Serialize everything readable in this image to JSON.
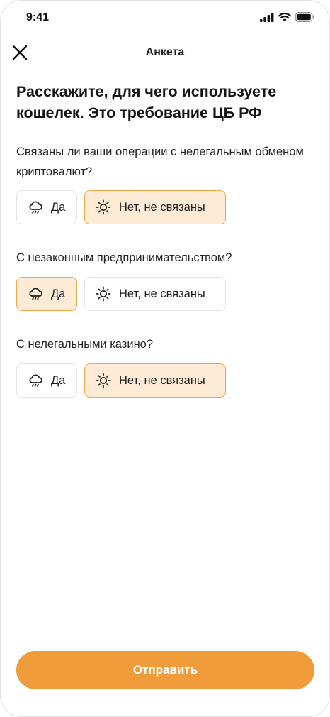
{
  "status_bar": {
    "time": "9:41"
  },
  "header": {
    "title": "Анкета",
    "close_icon": "close-icon"
  },
  "page": {
    "title": "Расскажите, для чего используете кошелек. Это требование ЦБ РФ"
  },
  "questions": [
    {
      "text": "Связаны ли ваши операции с нелегальным обменом криптовалют?",
      "yes_label": "Да",
      "no_label": "Нет, не связаны",
      "selected": "no"
    },
    {
      "text": "С незаконным предпринимательством?",
      "yes_label": "Да",
      "no_label": "Нет, не связаны",
      "selected": "yes"
    },
    {
      "text": "С нелегальными казино?",
      "yes_label": "Да",
      "no_label": "Нет, не связаны",
      "selected": "no"
    }
  ],
  "submit": {
    "label": "Отправить"
  },
  "colors": {
    "accent": "#f19c3a",
    "selected_bg": "#fdebd5",
    "selected_border": "#f0a749",
    "border": "#e3e3e3",
    "text": "#141414"
  },
  "icons": {
    "yes": "rain-cloud-icon",
    "no": "sun-icon"
  }
}
